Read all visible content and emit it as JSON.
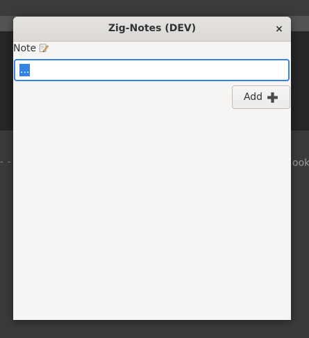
{
  "background": {
    "dashes": "- - -",
    "partial_text": "ook"
  },
  "dialog": {
    "title": "Zig-Notes (DEV)",
    "close_glyph": "×",
    "note_label": "Note",
    "note_icon": "memo-icon",
    "input_value": "...",
    "add_label": "Add",
    "add_icon": "plus-icon",
    "accent_color": "#3584e4"
  }
}
